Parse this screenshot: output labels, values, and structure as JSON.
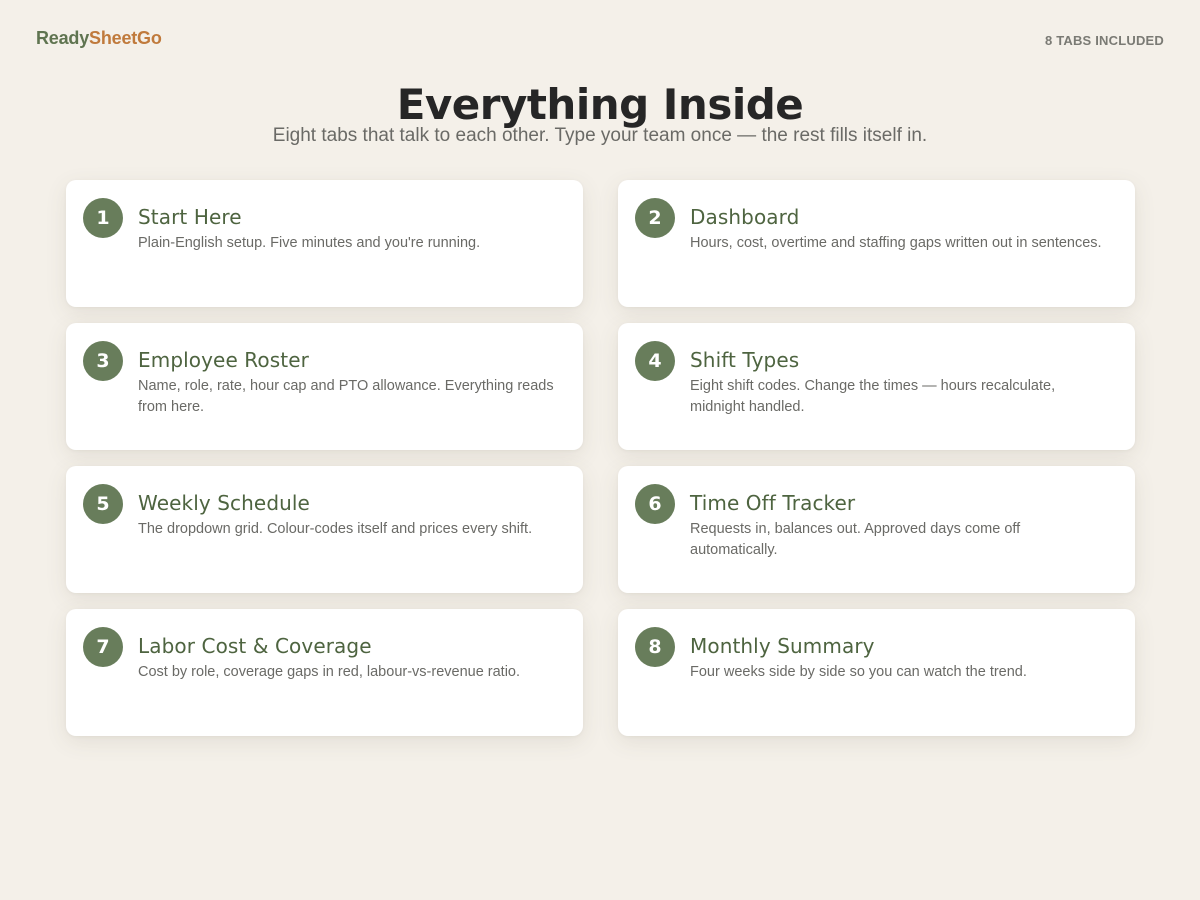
{
  "brand": {
    "part1": "Ready",
    "part2": "SheetGo"
  },
  "tabs_count": "8 TABS INCLUDED",
  "title": "Everything Inside",
  "subtitle": "Eight tabs that talk to each other. Type your team once — the rest fills itself in.",
  "colors": {
    "accent_green": "#687d5b",
    "brand_orange": "#c07a3c",
    "background": "#f4f0e9"
  },
  "cards": [
    {
      "number": "1",
      "title": "Start Here",
      "desc": "Plain-English setup. Five minutes and you're running."
    },
    {
      "number": "2",
      "title": "Dashboard",
      "desc": "Hours, cost, overtime and staffing gaps written out in sentences."
    },
    {
      "number": "3",
      "title": "Employee Roster",
      "desc": "Name, role, rate, hour cap and PTO allowance. Everything reads from here."
    },
    {
      "number": "4",
      "title": "Shift Types",
      "desc": "Eight shift codes. Change the times — hours recalculate, midnight handled."
    },
    {
      "number": "5",
      "title": "Weekly Schedule",
      "desc": "The dropdown grid. Colour-codes itself and prices every shift."
    },
    {
      "number": "6",
      "title": "Time Off Tracker",
      "desc": "Requests in, balances out. Approved days come off automatically."
    },
    {
      "number": "7",
      "title": "Labor Cost & Coverage",
      "desc": "Cost by role, coverage gaps in red, labour-vs-revenue ratio."
    },
    {
      "number": "8",
      "title": "Monthly Summary",
      "desc": "Four weeks side by side so you can watch the trend."
    }
  ]
}
